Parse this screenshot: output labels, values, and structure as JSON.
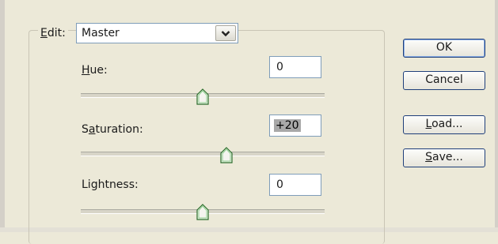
{
  "dialog": {
    "edit": {
      "label_mnemonic": "E",
      "label_rest": "dit:",
      "selected": "Master",
      "dropdown_icon": "chevron-down-icon"
    },
    "hue": {
      "label_mnemonic": "H",
      "label_rest": "ue:",
      "value": "0",
      "slider_value": 0
    },
    "saturation": {
      "label_pre": "S",
      "label_mnemonic": "a",
      "label_rest": "turation:",
      "value": "+20",
      "slider_value": 20
    },
    "lightness": {
      "label_mnemonic": "",
      "label_rest": "Lightness:",
      "value": "0",
      "slider_value": 0
    },
    "buttons": {
      "ok": "OK",
      "cancel": "Cancel",
      "load_mnemonic": "L",
      "load_rest": "oad...",
      "save_mnemonic": "S",
      "save_rest": "ave..."
    }
  }
}
